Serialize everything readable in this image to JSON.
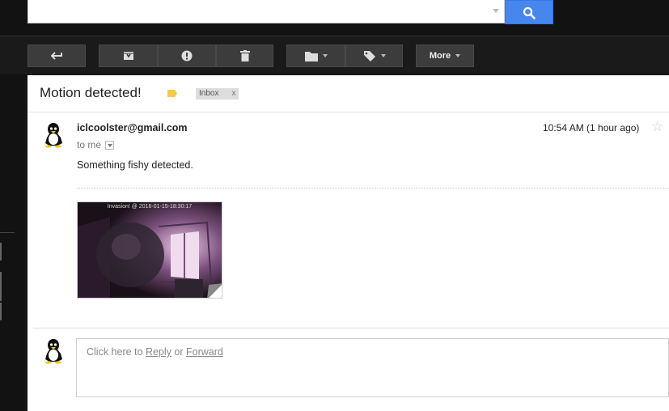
{
  "search": {
    "value": "",
    "placeholder": ""
  },
  "toolbar": {
    "buttons": [
      {
        "name": "reply-back-button",
        "icon": "arrow-back-icon"
      },
      {
        "name": "archive-button",
        "icon": "archive-icon"
      },
      {
        "name": "report-spam-button",
        "icon": "exclamation-icon"
      },
      {
        "name": "delete-button",
        "icon": "trash-icon"
      },
      {
        "name": "move-to-button",
        "icon": "folder-icon"
      },
      {
        "name": "labels-button",
        "icon": "tag-icon"
      }
    ],
    "more_label": "More"
  },
  "message": {
    "subject": "Motion detected!",
    "label_color": "#f7c94a",
    "inbox_chip": {
      "label": "Inbox",
      "remove": "x"
    },
    "sender": "iclcoolster@gmail.com",
    "to": "to me",
    "time": "10:54 AM (1 hour ago)",
    "body": "Something fishy detected.",
    "attachment_caption": "Invasion! @ 2016-01-15-18:30:17"
  },
  "reply": {
    "prefix": "Click here to ",
    "reply_link": "Reply",
    "or": " or ",
    "forward_link": "Forward"
  },
  "colors": {
    "accent": "#4787ed",
    "dark_bg": "#121212",
    "button_bg": "#3c3c3c"
  }
}
